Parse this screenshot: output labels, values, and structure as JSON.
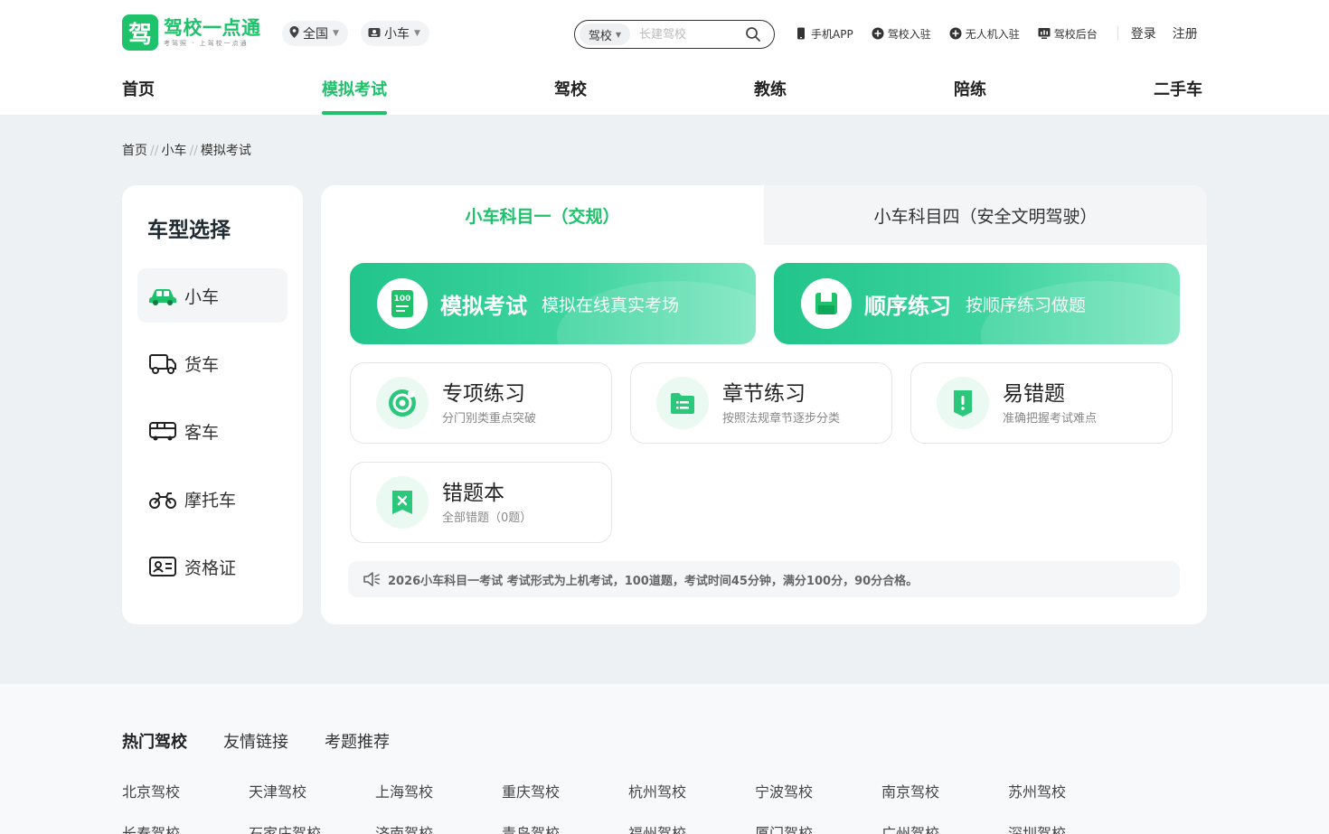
{
  "header": {
    "logo_mark": "驾",
    "logo_name": "驾校一点通",
    "logo_sub": "考驾照 · 上驾校一点通",
    "region": "全国",
    "vehicle": "小车",
    "search_type": "驾校",
    "search_placeholder": "长建驾校",
    "links": [
      "手机APP",
      "驾校入驻",
      "无人机入驻",
      "驾校后台"
    ],
    "login": "登录",
    "register": "注册"
  },
  "nav": [
    "首页",
    "模拟考试",
    "驾校",
    "教练",
    "陪练",
    "二手车"
  ],
  "breadcrumb": [
    "首页",
    "小车",
    "模拟考试"
  ],
  "breadcrumb_sep": "//",
  "sidebar": {
    "title": "车型选择",
    "items": [
      "小车",
      "货车",
      "客车",
      "摩托车",
      "资格证"
    ]
  },
  "tabs": [
    "小车科目一（交规）",
    "小车科目四（安全文明驾驶）"
  ],
  "big_cards": [
    {
      "title": "模拟考试",
      "sub": "模拟在线真实考场"
    },
    {
      "title": "顺序练习",
      "sub": "按顺序练习做题"
    }
  ],
  "cards": [
    {
      "title": "专项练习",
      "sub": "分门别类重点突破"
    },
    {
      "title": "章节练习",
      "sub": "按照法规章节逐步分类"
    },
    {
      "title": "易错题",
      "sub": "准确把握考试难点"
    },
    {
      "title": "错题本",
      "sub": "全部错题（0题）"
    }
  ],
  "notice": "2026小车科目一考试 考试形式为上机考试，100道题，考试时间45分钟，满分100分，90分合格。",
  "footer": {
    "tabs": [
      "热门驾校",
      "友情链接",
      "考题推荐"
    ],
    "links_row1": [
      "北京驾校",
      "天津驾校",
      "上海驾校",
      "重庆驾校",
      "杭州驾校",
      "宁波驾校",
      "南京驾校",
      "苏州驾校"
    ],
    "links_row2": [
      "长春驾校",
      "石家庄驾校",
      "济南驾校",
      "青岛驾校",
      "福州驾校",
      "厦门驾校",
      "广州驾校",
      "深圳驾校"
    ]
  },
  "colors": {
    "accent": "#1ec26b",
    "gradient_start": "#21c58b",
    "gradient_end": "#7be6c0"
  }
}
